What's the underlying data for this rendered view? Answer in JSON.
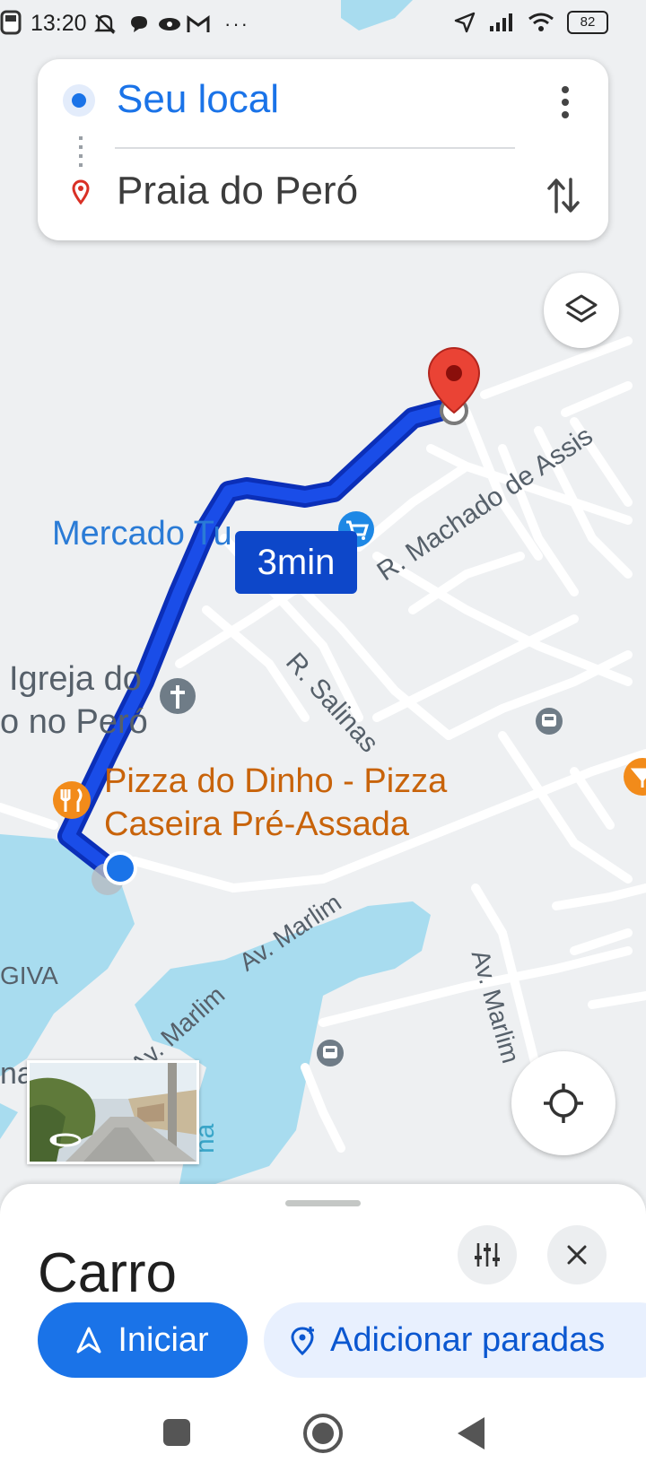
{
  "status_bar": {
    "time": "13:20",
    "battery": "82"
  },
  "directions": {
    "origin": "Seu local",
    "destination": "Praia do Peró"
  },
  "map": {
    "eta": "3min",
    "poi_mercado": "Mercado Tu",
    "poi_igreja_line1": "Igreja do",
    "poi_igreja_line2": "o no Peró",
    "poi_pizza_line1": "Pizza do Dinho - Pizza",
    "poi_pizza_line2": "Caseira Pré-Assada",
    "street_machado": "R. Machado de Assis",
    "street_salinas": "R. Salinas",
    "street_marlim_1": "Av. Marlim",
    "street_marlim_2": "Av. Marlim",
    "street_marlim_3": "Av. Marlim",
    "area_giva": "GIVA",
    "area_na": "na",
    "area_bottom": "na"
  },
  "sheet": {
    "mode": "Carro",
    "start_label": "Iniciar",
    "add_stops_label": "Adicionar paradas"
  },
  "colors": {
    "route": "#1a4de8",
    "accent": "#1a73e8",
    "water": "#a8dcef",
    "destination_pin": "#ea4335"
  }
}
